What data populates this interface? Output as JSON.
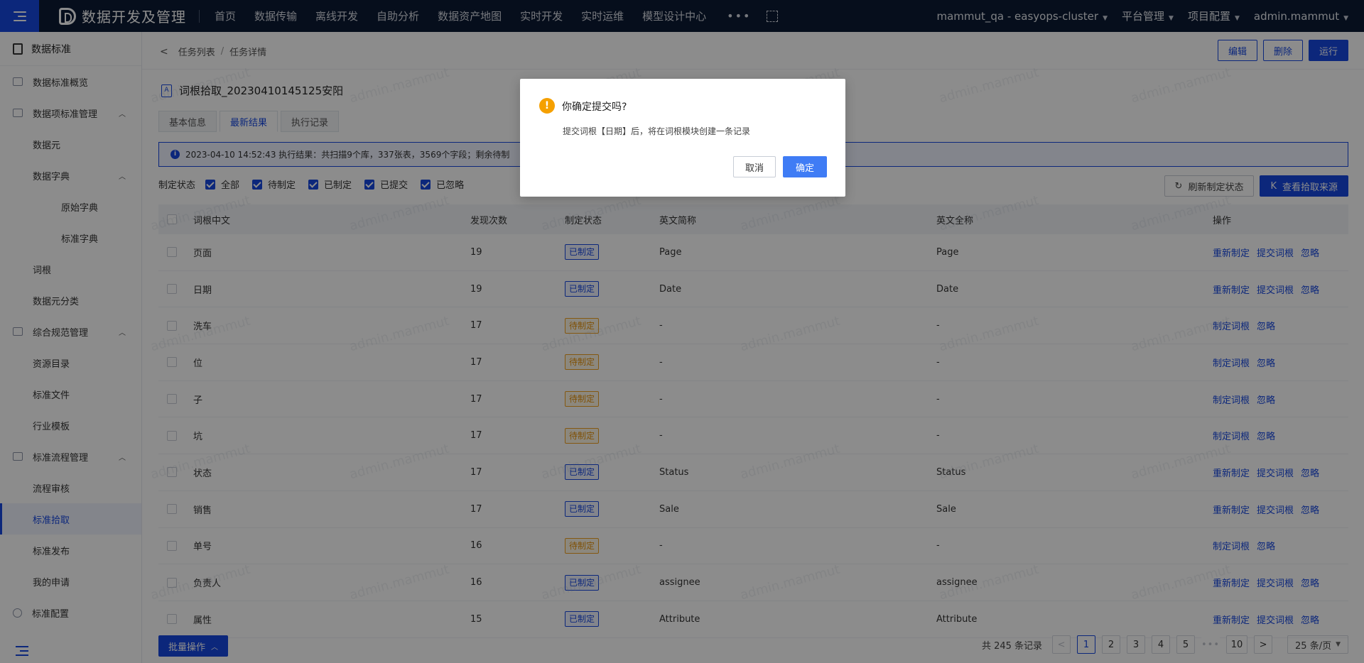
{
  "topbar": {
    "app_title": "数据开发及管理",
    "nav": [
      "首页",
      "数据传输",
      "离线开发",
      "自助分析",
      "数据资产地图",
      "实时开发",
      "实时运维",
      "模型设计中心"
    ],
    "more": "•••",
    "workspace": "mammut_qa - easyops-cluster",
    "platform": "平台管理",
    "project": "项目配置",
    "user": "admin.mammut"
  },
  "sidebar": {
    "title": "数据标准",
    "items": [
      {
        "label": "数据标准概览",
        "level": 0,
        "icon": "monitor-icon"
      },
      {
        "label": "数据项标准管理",
        "level": 0,
        "icon": "shield-icon",
        "expanded": true
      },
      {
        "label": "数据元",
        "level": 1
      },
      {
        "label": "数据字典",
        "level": 1,
        "expanded": true
      },
      {
        "label": "原始字典",
        "level": 2
      },
      {
        "label": "标准字典",
        "level": 2
      },
      {
        "label": "词根",
        "level": 1
      },
      {
        "label": "数据元分类",
        "level": 1
      },
      {
        "label": "综合规范管理",
        "level": 0,
        "icon": "folder-icon",
        "expanded": true
      },
      {
        "label": "资源目录",
        "level": 1
      },
      {
        "label": "标准文件",
        "level": 1
      },
      {
        "label": "行业模板",
        "level": 1
      },
      {
        "label": "标准流程管理",
        "level": 0,
        "icon": "flow-icon",
        "expanded": true
      },
      {
        "label": "流程审核",
        "level": 1
      },
      {
        "label": "标准拾取",
        "level": 1,
        "active": true
      },
      {
        "label": "标准发布",
        "level": 1
      },
      {
        "label": "我的申请",
        "level": 1
      },
      {
        "label": "标准配置",
        "level": 0,
        "icon": "gear-icon"
      }
    ]
  },
  "breadcrumb": {
    "items": [
      "任务列表",
      "任务详情"
    ],
    "separator": "/"
  },
  "header_buttons": {
    "edit": "编辑",
    "delete": "删除",
    "run": "运行"
  },
  "task": {
    "title": "词根拾取_20230410145125安阳",
    "icon_letter": "A"
  },
  "tabs": [
    {
      "label": "基本信息"
    },
    {
      "label": "最新结果",
      "active": true
    },
    {
      "label": "执行记录"
    }
  ],
  "info": {
    "text": "2023-04-10 14:52:43 执行结果：共扫描9个库，337张表，3569个字段；剩余待制"
  },
  "filter": {
    "label": "制定状态",
    "options": [
      "全部",
      "待制定",
      "已制定",
      "已提交",
      "已忽略"
    ],
    "refresh": "刷新制定状态",
    "view_source": "查看拾取来源"
  },
  "table": {
    "columns": [
      "词根中文",
      "发现次数",
      "制定状态",
      "英文简称",
      "英文全称",
      "操作"
    ],
    "rows": [
      {
        "name": "页面",
        "count": "19",
        "state": "已制定",
        "short": "Page",
        "full": "Page",
        "ops": [
          "重新制定",
          "提交词根",
          "忽略"
        ]
      },
      {
        "name": "日期",
        "count": "19",
        "state": "已制定",
        "short": "Date",
        "full": "Date",
        "ops": [
          "重新制定",
          "提交词根",
          "忽略"
        ]
      },
      {
        "name": "洗车",
        "count": "17",
        "state": "待制定",
        "short": "-",
        "full": "-",
        "ops": [
          "制定词根",
          "忽略"
        ]
      },
      {
        "name": "位",
        "count": "17",
        "state": "待制定",
        "short": "-",
        "full": "-",
        "ops": [
          "制定词根",
          "忽略"
        ]
      },
      {
        "name": "子",
        "count": "17",
        "state": "待制定",
        "short": "-",
        "full": "-",
        "ops": [
          "制定词根",
          "忽略"
        ]
      },
      {
        "name": "坑",
        "count": "17",
        "state": "待制定",
        "short": "-",
        "full": "-",
        "ops": [
          "制定词根",
          "忽略"
        ]
      },
      {
        "name": "状态",
        "count": "17",
        "state": "已制定",
        "short": "Status",
        "full": "Status",
        "ops": [
          "重新制定",
          "提交词根",
          "忽略"
        ]
      },
      {
        "name": "销售",
        "count": "17",
        "state": "已制定",
        "short": "Sale",
        "full": "Sale",
        "ops": [
          "重新制定",
          "提交词根",
          "忽略"
        ]
      },
      {
        "name": "单号",
        "count": "16",
        "state": "待制定",
        "short": "-",
        "full": "-",
        "ops": [
          "制定词根",
          "忽略"
        ]
      },
      {
        "name": "负责人",
        "count": "16",
        "state": "已制定",
        "short": "assignee",
        "full": "assignee",
        "ops": [
          "重新制定",
          "提交词根",
          "忽略"
        ]
      },
      {
        "name": "属性",
        "count": "15",
        "state": "已制定",
        "short": "Attribute",
        "full": "Attribute",
        "ops": [
          "重新制定",
          "提交词根",
          "忽略"
        ]
      }
    ]
  },
  "footer": {
    "batch": "批量操作",
    "total": "共 245 条记录",
    "pages": [
      "1",
      "2",
      "3",
      "4",
      "5"
    ],
    "dots": "•••",
    "last_page": "10",
    "current_page": "1",
    "page_size": "25 条/页"
  },
  "watermark": "admin.mammut",
  "modal": {
    "title": "你确定提交吗?",
    "text": "提交词根【日期】后，将在词根模块创建一条记录",
    "cancel": "取消",
    "ok": "确定"
  }
}
